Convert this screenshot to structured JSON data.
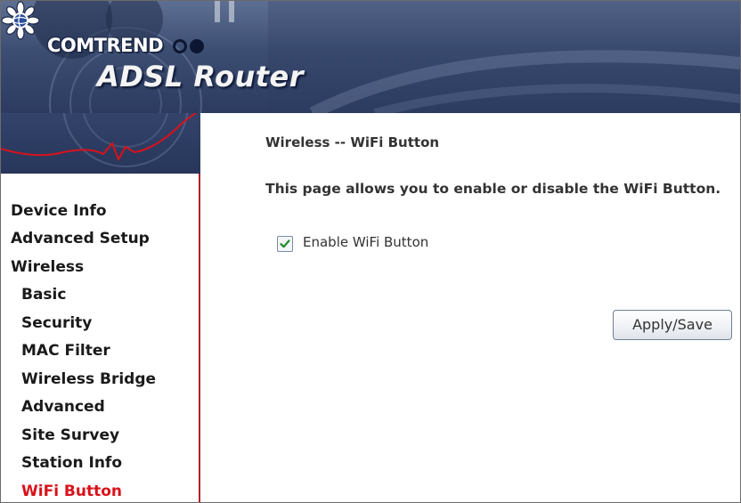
{
  "brand": {
    "company": "COMTREND",
    "product": "ADSL Router"
  },
  "sidebar": {
    "items": [
      {
        "label": "Device Info",
        "level": 0,
        "active": false
      },
      {
        "label": "Advanced Setup",
        "level": 0,
        "active": false
      },
      {
        "label": "Wireless",
        "level": 0,
        "active": false
      },
      {
        "label": "Basic",
        "level": 1,
        "active": false
      },
      {
        "label": "Security",
        "level": 1,
        "active": false
      },
      {
        "label": "MAC Filter",
        "level": 1,
        "active": false
      },
      {
        "label": "Wireless Bridge",
        "level": 1,
        "active": false
      },
      {
        "label": "Advanced",
        "level": 1,
        "active": false
      },
      {
        "label": "Site Survey",
        "level": 1,
        "active": false
      },
      {
        "label": "Station Info",
        "level": 1,
        "active": false
      },
      {
        "label": "WiFi Button",
        "level": 1,
        "active": true
      }
    ]
  },
  "main": {
    "heading": "Wireless -- WiFi Button",
    "description": "This page allows you to enable or disable the WiFi Button.",
    "enable_checkbox": {
      "label": "Enable WiFi Button",
      "checked": true
    },
    "apply_button": "Apply/Save"
  },
  "colors": {
    "active_nav": "#d8121b",
    "sidebar_border": "#b0202d",
    "banner_dark": "#2c3b5f"
  }
}
